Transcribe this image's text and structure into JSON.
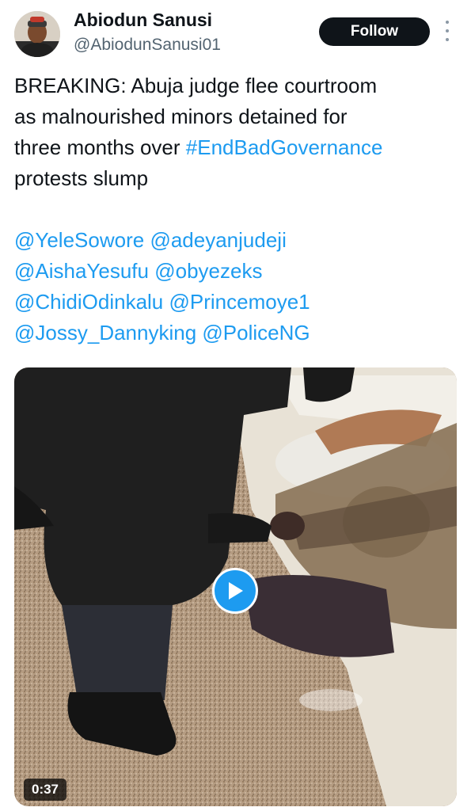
{
  "author": {
    "name": "Abiodun Sanusi",
    "handle": "@AbiodunSanusi01",
    "avatar_icon": "user-avatar-photo"
  },
  "actions": {
    "follow_label": "Follow",
    "more_icon": "more-vertical-icon"
  },
  "tweet": {
    "line1": "BREAKING: Abuja judge flee courtroom",
    "line2": "as malnourished minors detained for",
    "line3_prefix": "three months over ",
    "hashtag": "#EndBadGovernance",
    "line4": "protests slump",
    "mentions": [
      "@YeleSowore",
      "@adeyanjudeji",
      "@AishaYesufu",
      "@obyezeks",
      "@ChidiOdinkalu",
      "@Princemoye1",
      "@Jossy_Dannyking",
      "@PoliceNG"
    ]
  },
  "media": {
    "type": "video",
    "duration": "0:37",
    "play_icon": "play-icon"
  },
  "colors": {
    "link": "#1d9bf0",
    "text": "#0f1419",
    "secondary": "#536471",
    "follow_bg": "#0f1419"
  }
}
